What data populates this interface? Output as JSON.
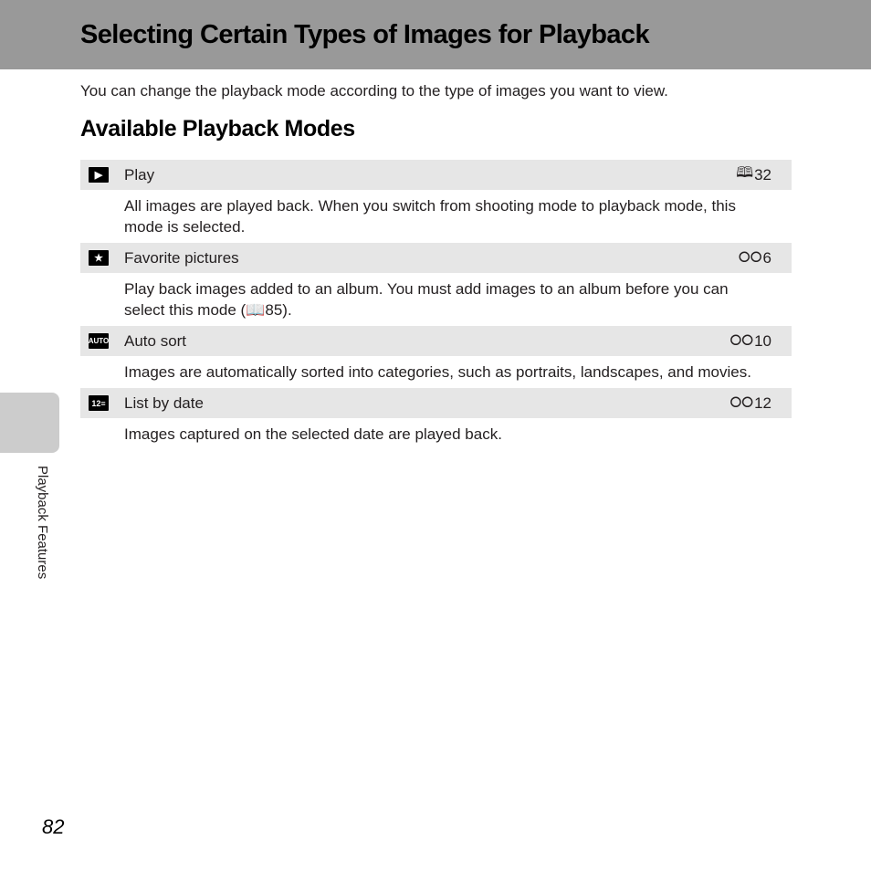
{
  "header": {
    "title": "Selecting Certain Types of Images for Playback"
  },
  "intro": "You can change the playback mode according to the type of images you want to view.",
  "section": {
    "heading": "Available Playback Modes"
  },
  "modes": [
    {
      "icon": "play-icon",
      "icon_glyph": "▶",
      "label": "Play",
      "ref_icon": "book-icon",
      "ref_glyph": "📖",
      "ref_page": "32",
      "description": "All images are played back. When you switch from shooting mode to playback mode, this mode is selected."
    },
    {
      "icon": "favorite-star-icon",
      "icon_glyph": "★",
      "label": "Favorite pictures",
      "ref_icon": "binoculars-icon",
      "ref_glyph": "🔭",
      "ref_page": "6",
      "description": "Play back images added to an album. You must add images to an album before you can select this mode (📖85)."
    },
    {
      "icon": "auto-sort-icon",
      "icon_glyph": "AUTO",
      "label": "Auto sort",
      "ref_icon": "binoculars-icon",
      "ref_glyph": "🔭",
      "ref_page": "10",
      "description": "Images are automatically sorted into categories, such as portraits, landscapes, and movies."
    },
    {
      "icon": "list-by-date-icon",
      "icon_glyph": "12≡",
      "label": "List by date",
      "ref_icon": "binoculars-icon",
      "ref_glyph": "🔭",
      "ref_page": "12",
      "description": "Images captured on the selected date are played back."
    }
  ],
  "side_label": "Playback Features",
  "page_number": "82"
}
